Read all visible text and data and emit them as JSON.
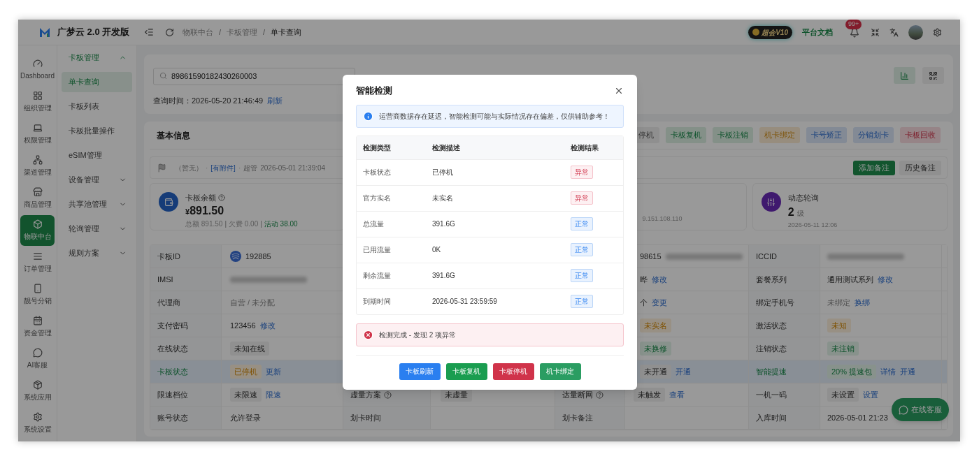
{
  "header": {
    "brand": "广梦云 2.0 开发版",
    "breadcrumb": [
      {
        "kind": "link",
        "text": "物联中台"
      },
      {
        "kind": "sep",
        "text": "/"
      },
      {
        "kind": "link",
        "text": "卡板管理"
      },
      {
        "kind": "sep",
        "text": "/"
      },
      {
        "kind": "current",
        "text": "单卡查询"
      }
    ],
    "vip_badge": "超会V10",
    "docs_link": "平台文档",
    "notification_count": "99+"
  },
  "rail": {
    "items": [
      {
        "label": "Dashboard",
        "selected": false
      },
      {
        "label": "组织管理",
        "selected": false
      },
      {
        "label": "权限管理",
        "selected": false
      },
      {
        "label": "渠道管理",
        "selected": false
      },
      {
        "label": "商品管理",
        "selected": false
      },
      {
        "label": "物联中台",
        "selected": true
      },
      {
        "label": "订单管理",
        "selected": false
      },
      {
        "label": "靓号分销",
        "selected": false
      },
      {
        "label": "资金管理",
        "selected": false
      },
      {
        "label": "AI客服",
        "selected": false
      },
      {
        "label": "系统应用",
        "selected": false
      },
      {
        "label": "系统设置",
        "selected": false
      }
    ]
  },
  "submenu": {
    "items": [
      {
        "label": "卡板管理",
        "expanded": true,
        "children": [
          {
            "label": "单卡查询",
            "selected": true
          },
          {
            "label": "卡板列表",
            "selected": false
          },
          {
            "label": "卡板批量操作",
            "selected": false
          },
          {
            "label": "eSIM管理",
            "selected": false
          }
        ]
      },
      {
        "label": "设备管理",
        "expanded": false
      },
      {
        "label": "共享池管理",
        "expanded": false
      },
      {
        "label": "轮询管理",
        "expanded": false
      },
      {
        "label": "规则方案",
        "expanded": false
      }
    ]
  },
  "search": {
    "value": "89861590182430260003",
    "query_time_label": "查询时间：",
    "query_time": "2026-05-20 21:46:49",
    "refresh_link": "刷新"
  },
  "basic_info": {
    "title": "基本信息",
    "actions": [
      {
        "label": "停机",
        "kind": "neutral"
      },
      {
        "label": "卡板复机",
        "kind": "success"
      },
      {
        "label": "卡板注销",
        "kind": "success"
      },
      {
        "label": "机卡绑定",
        "kind": "warning"
      },
      {
        "label": "卡号矫正",
        "kind": "info"
      },
      {
        "label": "分销划卡",
        "kind": "info"
      },
      {
        "label": "卡板回收",
        "kind": "danger"
      }
    ],
    "remark": {
      "parts": [
        {
          "kind": "muted",
          "text": "（暂无）"
        },
        {
          "kind": "dot",
          "text": "·"
        },
        {
          "kind": "link",
          "text": "[有附件]"
        },
        {
          "kind": "dot",
          "text": "·"
        },
        {
          "kind": "muted",
          "text": "超管"
        },
        {
          "kind": "muted",
          "text": "2026-05-01 21:39:04"
        }
      ],
      "buttons": [
        {
          "label": "添加备注",
          "kind": "primary"
        },
        {
          "label": "历史备注",
          "kind": "plain"
        }
      ]
    },
    "cards": [
      {
        "kind": "balance",
        "title": "卡板余额",
        "currency": "¥",
        "amount": "891.50",
        "stats": [
          {
            "kind": "muted",
            "text": "总额 891.50"
          },
          {
            "kind": "sep",
            "text": "|"
          },
          {
            "kind": "muted",
            "text": "欠费 0.00"
          },
          {
            "kind": "sep",
            "text": "|"
          },
          {
            "kind": "green",
            "text": "活动 38.00"
          }
        ]
      },
      {
        "kind": "partial",
        "text": "9.151.108.110"
      },
      {
        "kind": "stat",
        "title": "动态轮询",
        "value": "2",
        "unit": "级",
        "time": "2026-05-11 12:06"
      }
    ],
    "table": {
      "rows": [
        {
          "highlighted": false,
          "c1_label": "卡板ID",
          "c1_value": [
            {
              "kind": "operator"
            },
            {
              "kind": "text",
              "text": "192885"
            }
          ],
          "c3_value": [
            {
              "kind": "text",
              "text": "98615"
            },
            {
              "kind": "blurred"
            }
          ],
          "c4_label": "ICCID",
          "c4_value": [
            {
              "kind": "blurred"
            }
          ]
        },
        {
          "highlighted": false,
          "c1_label": "IMSI",
          "c1_value": [
            {
              "kind": "blurred"
            }
          ],
          "c3_value": [
            {
              "kind": "text",
              "text": "晔"
            },
            {
              "kind": "link",
              "text": "修改"
            }
          ],
          "c4_label": "套餐系列",
          "c4_value": [
            {
              "kind": "text",
              "text": "通用测试系列"
            },
            {
              "kind": "link",
              "text": "修改"
            }
          ]
        },
        {
          "highlighted": false,
          "c1_label": "代理商",
          "c1_value": [
            {
              "kind": "muted",
              "text": "自营 / 未分配"
            }
          ],
          "c3_value": [
            {
              "kind": "text",
              "text": "个"
            },
            {
              "kind": "link",
              "text": "变更"
            }
          ],
          "c4_label": "绑定手机号",
          "c4_value": [
            {
              "kind": "muted",
              "text": "未绑定"
            },
            {
              "kind": "link",
              "text": "换绑"
            }
          ]
        },
        {
          "highlighted": false,
          "c1_label": "支付密码",
          "c1_value": [
            {
              "kind": "text",
              "text": "123456"
            },
            {
              "kind": "link",
              "text": "修改"
            }
          ],
          "c3_value": [
            {
              "kind": "warning",
              "text": "未实名"
            }
          ],
          "c4_label": "激活状态",
          "c4_value": [
            {
              "kind": "warning",
              "text": "未知"
            }
          ]
        },
        {
          "highlighted": false,
          "c1_label": "在线状态",
          "c1_value": [
            {
              "kind": "neutral",
              "text": "未知在线"
            }
          ],
          "c3_value": [
            {
              "kind": "success",
              "text": "未换修"
            }
          ],
          "c4_label": "注销状态",
          "c4_value": [
            {
              "kind": "success",
              "text": "未注销"
            }
          ]
        },
        {
          "highlighted": true,
          "c1_label": "卡板状态",
          "c1_value": [
            {
              "kind": "warning",
              "text": "已停机"
            },
            {
              "kind": "link",
              "text": "更新"
            }
          ],
          "c3_value": [
            {
              "kind": "neutral",
              "text": "未开通"
            },
            {
              "kind": "link",
              "text": "开通"
            }
          ],
          "c4_label": "智能提速",
          "c4_value": [
            {
              "kind": "success",
              "text": "20% 提速包"
            },
            {
              "kind": "link",
              "text": "详情"
            },
            {
              "kind": "link",
              "text": "开通"
            }
          ]
        },
        {
          "highlighted": false,
          "c1_label": "限速档位",
          "c1_value": [
            {
              "kind": "neutral",
              "text": "未限速"
            },
            {
              "kind": "link",
              "text": "限速"
            }
          ],
          "c2_label": "虚量方案",
          "c2_help": true,
          "c2_value": [
            {
              "kind": "neutral",
              "text": "未虚量"
            }
          ],
          "c3_label": "达量断网",
          "c3_help": true,
          "c3_value": [
            {
              "kind": "neutral",
              "text": "未触发"
            },
            {
              "kind": "link",
              "text": "查看"
            }
          ],
          "c4_label": "一机一码",
          "c4_value": [
            {
              "kind": "neutral",
              "text": "未设置"
            },
            {
              "kind": "link",
              "text": "设置"
            }
          ]
        },
        {
          "highlighted": false,
          "c1_label": "账号状态",
          "c1_value": [
            {
              "kind": "text",
              "text": "允许登录"
            }
          ],
          "c2_label": "划卡时间",
          "c3_label": "划卡备注",
          "c4_label": "入库时间",
          "c4_value": [
            {
              "kind": "text",
              "text": "2026-05-01 21:23"
            }
          ]
        }
      ]
    }
  },
  "modal": {
    "title": "智能检测",
    "notice": "运营商数据存在延迟，智能检测可能与实际情况存在偏差，仅供辅助参考！",
    "columns": [
      "检测类型",
      "检测描述",
      "检测结果"
    ],
    "rows": [
      {
        "type": "卡板状态",
        "desc": "已停机",
        "result": "异常",
        "kind": "abnormal"
      },
      {
        "type": "官方实名",
        "desc": "未实名",
        "result": "异常",
        "kind": "abnormal"
      },
      {
        "type": "总流量",
        "desc": "391.6G",
        "result": "正常",
        "kind": "normal"
      },
      {
        "type": "已用流量",
        "desc": "0K",
        "result": "正常",
        "kind": "normal"
      },
      {
        "type": "剩余流量",
        "desc": "391.6G",
        "result": "正常",
        "kind": "normal"
      },
      {
        "type": "到期时间",
        "desc": "2026-05-31 23:59:59",
        "result": "正常",
        "kind": "normal"
      }
    ],
    "summary": "检测完成 - 发现 2 项异常",
    "buttons": [
      {
        "label": "卡板刷新",
        "kind": "info"
      },
      {
        "label": "卡板复机",
        "kind": "success"
      },
      {
        "label": "卡板停机",
        "kind": "danger"
      },
      {
        "label": "机卡绑定",
        "kind": "confirm"
      }
    ]
  },
  "chat_button": "在线客服"
}
